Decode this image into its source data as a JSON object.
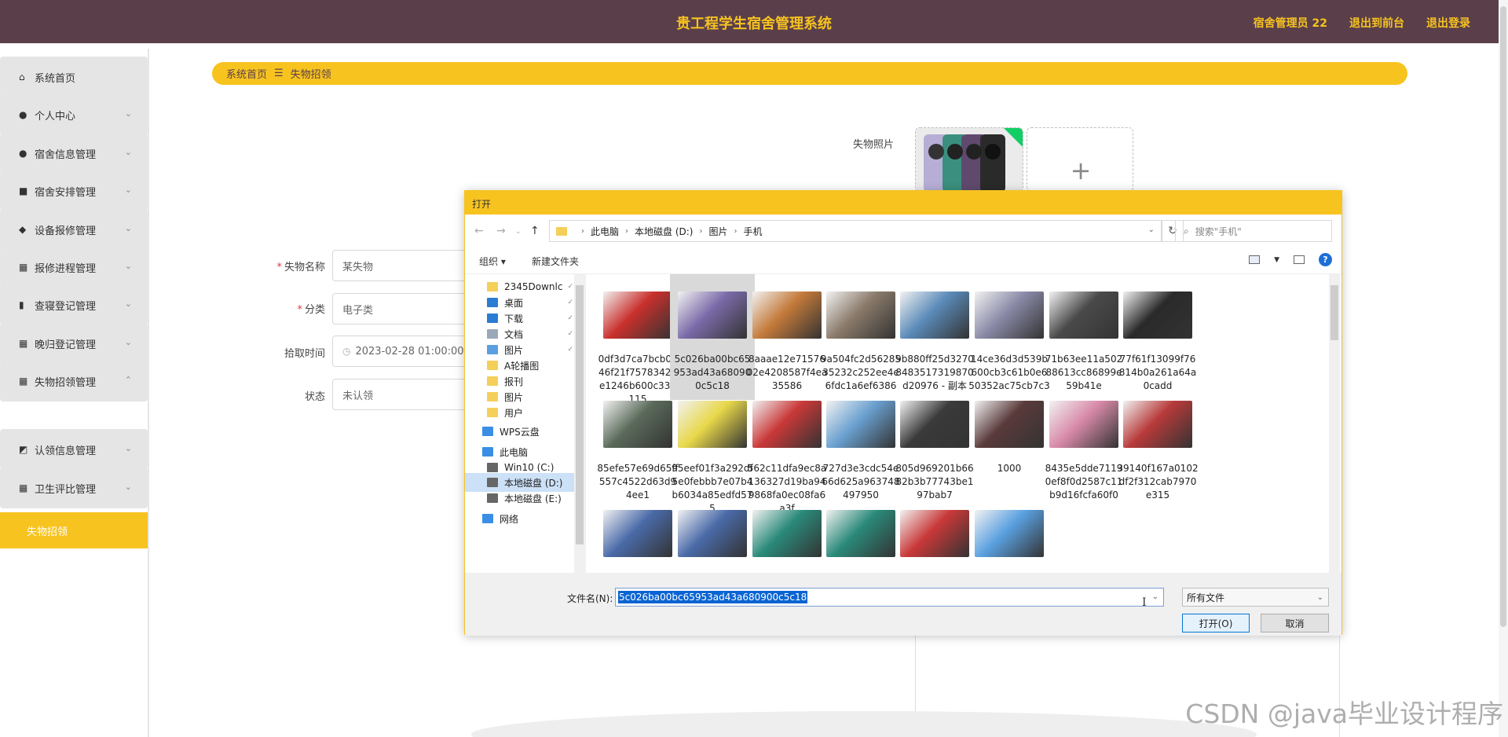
{
  "header": {
    "title": "贵工程学生宿舍管理系统",
    "links": [
      "宿舍管理员 22",
      "退出到前台",
      "退出登录"
    ]
  },
  "sidebar": {
    "items": [
      {
        "label": "系统首页",
        "icon": "home-icon",
        "glyph": "⌂",
        "caret": ""
      },
      {
        "label": "个人中心",
        "icon": "person-icon",
        "glyph": "●",
        "caret": "⌄"
      },
      {
        "label": "宿舍信息管理",
        "icon": "person-icon",
        "glyph": "●",
        "caret": "⌄"
      },
      {
        "label": "宿舍安排管理",
        "icon": "monitor-icon",
        "glyph": "■",
        "caret": "⌄"
      },
      {
        "label": "设备报修管理",
        "icon": "pin-icon",
        "glyph": "◆",
        "caret": "⌄"
      },
      {
        "label": "报修进程管理",
        "icon": "grid-icon",
        "glyph": "▦",
        "caret": "⌄"
      },
      {
        "label": "查寝登记管理",
        "icon": "bar-chart-icon",
        "glyph": "▮",
        "caret": "⌄"
      },
      {
        "label": "晚归登记管理",
        "icon": "grid-icon",
        "glyph": "▦",
        "caret": "⌄"
      },
      {
        "label": "失物招领管理",
        "icon": "grid-icon",
        "glyph": "▦",
        "caret": "⌃"
      },
      {
        "label": "认领信息管理",
        "icon": "chart-icon",
        "glyph": "◩",
        "caret": "⌄"
      },
      {
        "label": "卫生评比管理",
        "icon": "grid-icon",
        "glyph": "▦",
        "caret": "⌄"
      }
    ],
    "active_sub": "失物招领"
  },
  "breadcrumb": {
    "home": "系统首页",
    "sep": "☰",
    "current": "失物招领"
  },
  "form": {
    "name_label": "失物名称",
    "name_value": "某失物",
    "category_label": "分类",
    "category_value": "电子类",
    "time_label": "拾取时间",
    "time_value": "2023-02-28 01:00:00",
    "status_label": "状态",
    "status_value": "未认领",
    "photo_label": "失物照片",
    "required_mark": "*",
    "add_glyph": "+"
  },
  "dialog": {
    "title": "打开",
    "path": [
      "此电脑",
      "本地磁盘 (D:)",
      "图片",
      "手机"
    ],
    "search_placeholder": "搜索\"手机\"",
    "toolbar": {
      "organize": "组织 ▾",
      "new_folder": "新建文件夹",
      "help": "?"
    },
    "nav_items": [
      {
        "label": "2345Downlc",
        "icon": "folder-icon",
        "color": "#f4cf5a",
        "pin": "📌"
      },
      {
        "label": "桌面",
        "icon": "desktop-icon",
        "color": "#2b7cd3",
        "pin": "📌"
      },
      {
        "label": "下载",
        "icon": "download-icon",
        "color": "#2b7cd3",
        "pin": "📌"
      },
      {
        "label": "文档",
        "icon": "document-icon",
        "color": "#9aa8b8",
        "pin": "📌"
      },
      {
        "label": "图片",
        "icon": "pictures-icon",
        "color": "#5aa0e0",
        "pin": "📌"
      },
      {
        "label": "A轮播图",
        "icon": "folder-icon",
        "color": "#f4cf5a",
        "pin": ""
      },
      {
        "label": "报刊",
        "icon": "folder-icon",
        "color": "#f4cf5a",
        "pin": ""
      },
      {
        "label": "图片",
        "icon": "folder-icon",
        "color": "#f4cf5a",
        "pin": ""
      },
      {
        "label": "用户",
        "icon": "folder-icon",
        "color": "#f4cf5a",
        "pin": ""
      },
      {
        "label": "WPS云盘",
        "icon": "cloud-icon",
        "color": "#3a8ee6",
        "pin": ""
      },
      {
        "label": "此电脑",
        "icon": "computer-icon",
        "color": "#3a8ee6",
        "pin": ""
      },
      {
        "label": "Win10 (C:)",
        "icon": "drive-icon",
        "color": "#666666",
        "pin": ""
      },
      {
        "label": "本地磁盘 (D:)",
        "icon": "drive-icon",
        "color": "#666666",
        "pin": ""
      },
      {
        "label": "本地磁盘 (E:)",
        "icon": "drive-icon",
        "color": "#666666",
        "pin": ""
      },
      {
        "label": "网络",
        "icon": "network-icon",
        "color": "#3a8ee6",
        "pin": ""
      }
    ],
    "files": [
      {
        "name": "0df3d7ca7bcb0a46f21f75783429e1246b600c330115",
        "color": "#c9302c"
      },
      {
        "name": "5c026ba00bc65953ad43a680900c5c18",
        "color": "#7a6aa8"
      },
      {
        "name": "8aaae12e7157602e4208587f4ea35586",
        "color": "#c47a3a"
      },
      {
        "name": "9a504fc2d5628535232c252ee4e6fdc1a6ef6386",
        "color": "#8a7a6a"
      },
      {
        "name": "9b880ff25d32708483517319870d20976 - 副本",
        "color": "#5a8ab8"
      },
      {
        "name": "14ce36d3d539b600cb3c61b0e650352ac75cb7c3",
        "color": "#8a8aa8"
      },
      {
        "name": "71b63ee11a50288613cc86899e59b41e",
        "color": "#4a4a4a"
      },
      {
        "name": "77f61f13099f76814b0a261a64a0cadd",
        "color": "#2a2a2a"
      },
      {
        "name": "85efe57e69d65ff557c4522d63d94ee1",
        "color": "#5a6a5a"
      },
      {
        "name": "95eef01f3a292df5e0febbb7e07b4b6034a85edfd575",
        "color": "#e8d84a"
      },
      {
        "name": "562c11dfa9ec8a136327d19ba949868fa0ec08fa6a3f",
        "color": "#c93838"
      },
      {
        "name": "727d3e3cdc54e66d625a963748497950",
        "color": "#6aa0d0"
      },
      {
        "name": "805d969201b6682b3b77743be197bab7",
        "color": "#3a3a3a"
      },
      {
        "name": "1000",
        "color": "#5a3a3a"
      },
      {
        "name": "8435e5dde71190ef8f0d2587c11b9d16fcfa60f0",
        "color": "#d88aa8"
      },
      {
        "name": "39140f167a0102df2f312cab7970e315",
        "color": "#b83a3a"
      },
      {
        "name": "",
        "color": "#4a6aa8"
      },
      {
        "name": "",
        "color": "#4a6aa8"
      },
      {
        "name": "",
        "color": "#2a8a7a"
      },
      {
        "name": "",
        "color": "#2a8a7a"
      },
      {
        "name": "",
        "color": "#c93838"
      },
      {
        "name": "",
        "color": "#5aa0e0"
      }
    ],
    "filename_label": "文件名(N):",
    "filename_value": "5c026ba00bc65953ad43a680900c5c18",
    "filetype_value": "所有文件",
    "open_label": "打开(O)",
    "cancel_label": "取消"
  },
  "watermark": "CSDN @java毕业设计程序"
}
